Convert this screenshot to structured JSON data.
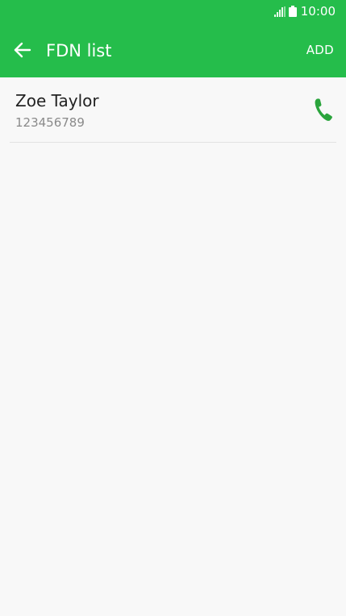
{
  "status_bar": {
    "time": "10:00",
    "icons": [
      "signal-icon",
      "battery-icon"
    ]
  },
  "app_bar": {
    "title": "FDN list",
    "back_icon": "arrow-left-icon",
    "add_label": "ADD"
  },
  "contacts": [
    {
      "name": "Zoe Taylor",
      "number": "123456789",
      "action_icon": "phone-icon"
    }
  ],
  "colors": {
    "accent": "#25bd4b",
    "call_icon": "#2aa43c",
    "background": "#f8f8f8",
    "primary_text": "#222222",
    "secondary_text": "#8a8a8a",
    "divider": "#e2e2e2"
  }
}
